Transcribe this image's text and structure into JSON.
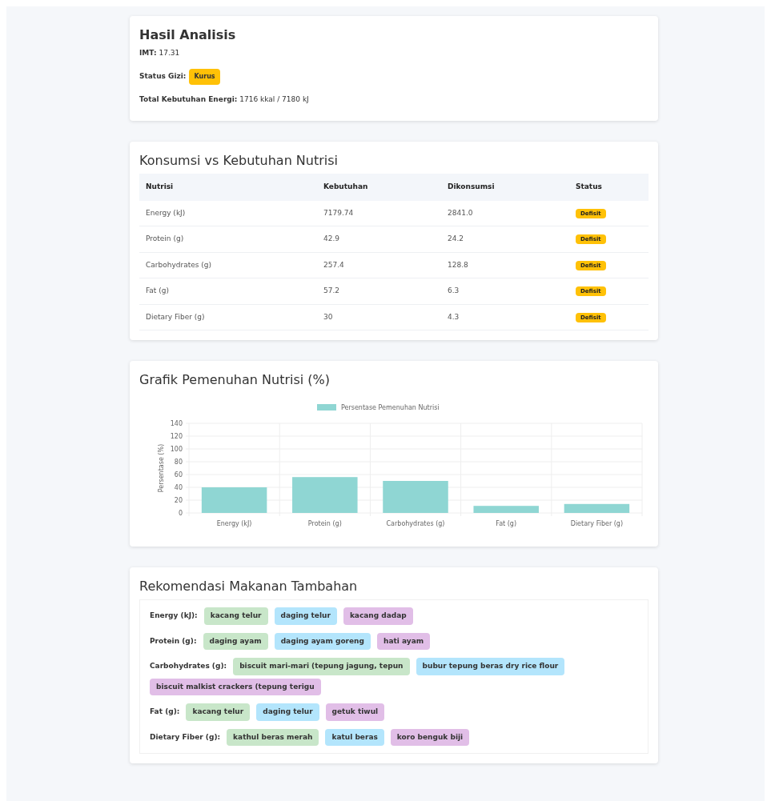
{
  "summary": {
    "title": "Hasil Analisis",
    "imt_label": "IMT:",
    "imt_value": "17.31",
    "status_label": "Status Gizi:",
    "status_value": "Kurus",
    "energy_label": "Total Kebutuhan Energi:",
    "energy_value": "1716 kkal / 7180 kJ"
  },
  "table": {
    "title": "Konsumsi vs Kebutuhan Nutrisi",
    "columns": [
      "Nutrisi",
      "Kebutuhan",
      "Dikonsumsi",
      "Status"
    ],
    "rows": [
      {
        "nutrient": "Energy (kJ)",
        "need": "7179.74",
        "consumed": "2841.0",
        "status": "Defisit"
      },
      {
        "nutrient": "Protein (g)",
        "need": "42.9",
        "consumed": "24.2",
        "status": "Defisit"
      },
      {
        "nutrient": "Carbohydrates (g)",
        "need": "257.4",
        "consumed": "128.8",
        "status": "Defisit"
      },
      {
        "nutrient": "Fat (g)",
        "need": "57.2",
        "consumed": "6.3",
        "status": "Defisit"
      },
      {
        "nutrient": "Dietary Fiber (g)",
        "need": "30",
        "consumed": "4.3",
        "status": "Defisit"
      }
    ]
  },
  "chart": {
    "title": "Grafik Pemenuhan Nutrisi (%)",
    "chart_data": {
      "type": "bar",
      "ylabel": "Persentase (%)",
      "categories": [
        "Energy (kJ)",
        "Protein (g)",
        "Carbohydrates (g)",
        "Fat (g)",
        "Dietary Fiber (g)"
      ],
      "series": [
        {
          "name": "Persentase Pemenuhan Nutrisi",
          "color": "#8fd6d3",
          "values": [
            40,
            56,
            50,
            11,
            14
          ]
        }
      ],
      "grid": true,
      "ylim": [
        0,
        140
      ],
      "yticks": [
        0,
        20,
        40,
        60,
        80,
        100,
        120,
        140
      ]
    }
  },
  "recommendations": {
    "title": "Rekomendasi Makanan Tambahan",
    "groups": [
      {
        "label": "Energy (kJ):",
        "foods": [
          {
            "text": "kacang telur",
            "color": "#c8e6c9"
          },
          {
            "text": "daging telur",
            "color": "#b3e5fc"
          },
          {
            "text": "kacang dadap",
            "color": "#e1bee7"
          }
        ]
      },
      {
        "label": "Protein (g):",
        "foods": [
          {
            "text": "daging ayam",
            "color": "#c8e6c9"
          },
          {
            "text": "daging ayam goreng",
            "color": "#b3e5fc"
          },
          {
            "text": "hati ayam",
            "color": "#e1bee7"
          }
        ]
      },
      {
        "label": "Carbohydrates (g):",
        "foods": [
          {
            "text": "biscuit mari-mari (tepung jagung, tepun",
            "color": "#c8e6c9"
          },
          {
            "text": "bubur tepung beras dry rice flour",
            "color": "#b3e5fc"
          },
          {
            "text": "biscuit malkist crackers (tepung terigu",
            "color": "#e1bee7"
          }
        ]
      },
      {
        "label": "Fat (g):",
        "foods": [
          {
            "text": "kacang telur",
            "color": "#c8e6c9"
          },
          {
            "text": "daging telur",
            "color": "#b3e5fc"
          },
          {
            "text": "getuk tiwul",
            "color": "#e1bee7"
          }
        ]
      },
      {
        "label": "Dietary Fiber (g):",
        "foods": [
          {
            "text": "kathul beras merah",
            "color": "#c8e6c9"
          },
          {
            "text": "katul beras",
            "color": "#b3e5fc"
          },
          {
            "text": "koro benguk biji",
            "color": "#e1bee7"
          }
        ]
      }
    ]
  }
}
